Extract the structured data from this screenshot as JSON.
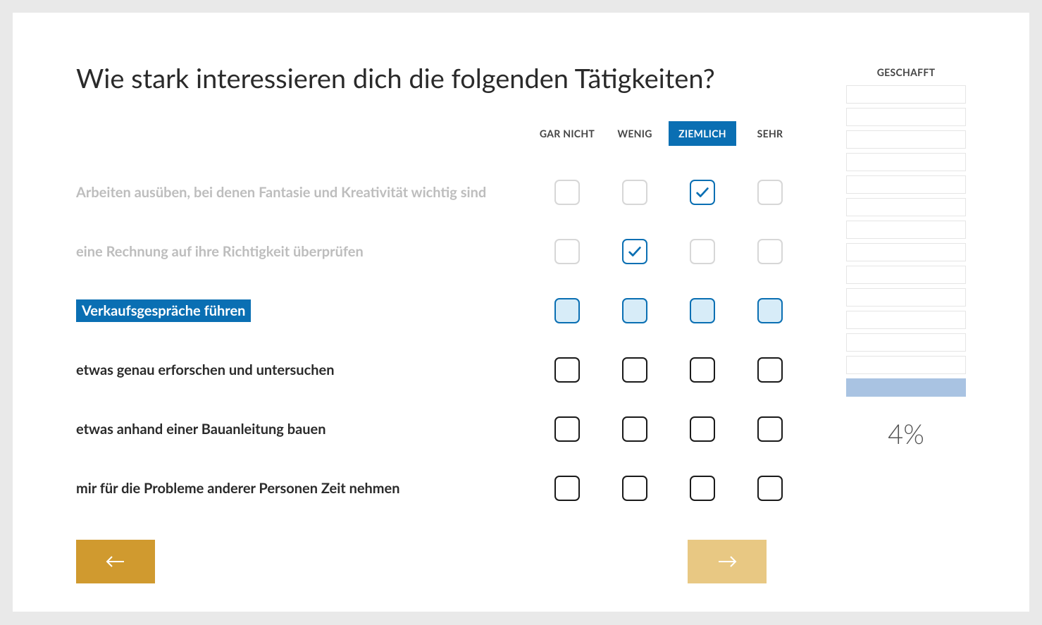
{
  "title": "Wie stark interessieren dich die folgenden Tätigkeiten?",
  "columns": [
    "GAR NICHT",
    "WENIG",
    "ZIEMLICH",
    "SEHR"
  ],
  "highlight_col_index": 2,
  "questions": [
    {
      "text": "Arbeiten ausüben, bei denen Fantasie und Kreativität wichtig sind",
      "state": "answered",
      "answer_index": 2
    },
    {
      "text": "eine Rechnung auf ihre Richtigkeit überprüfen",
      "state": "answered",
      "answer_index": 1
    },
    {
      "text": "Verkaufsgespräche führen",
      "state": "active",
      "answer_index": null
    },
    {
      "text": "etwas genau erforschen und untersuchen",
      "state": "pending",
      "answer_index": null
    },
    {
      "text": "etwas anhand einer Bauanleitung bauen",
      "state": "pending",
      "answer_index": null
    },
    {
      "text": "mir für die Probleme anderer Personen Zeit nehmen",
      "state": "pending",
      "answer_index": null
    }
  ],
  "progress": {
    "label": "GESCHAFFT",
    "segments": 14,
    "filled_segment_index": 13,
    "percent": "4%"
  },
  "colors": {
    "brand_blue": "#0a6fb3",
    "light_blue_fill": "#d7ecf8",
    "gold": "#d09a2f",
    "gold_light": "#e8c883",
    "progress_fill": "#a9c3e2"
  }
}
